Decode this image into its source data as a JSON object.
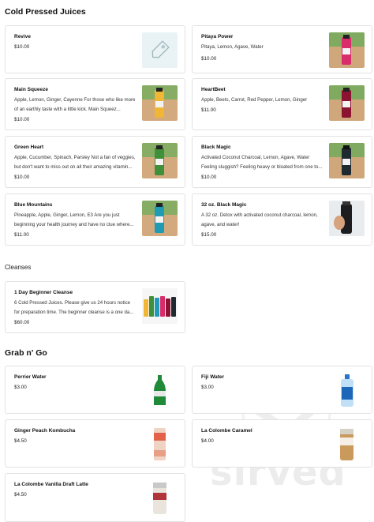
{
  "sections": {
    "cold_pressed": "Cold Pressed Juices",
    "cleanses": "Cleanses",
    "grab_n_go": "Grab n' Go"
  },
  "items": {
    "revive": {
      "name": "Revive",
      "desc": "",
      "price": "$10.00"
    },
    "pitaya": {
      "name": "Pitaya Power",
      "desc": "Pitaya, Lemon, Agave, Water",
      "price": "$10.00"
    },
    "main_squeeze": {
      "name": "Main Squeeze",
      "desc": "Apple, Lemon, Ginger, Cayenne For those who like more of an earthly taste with a little kick. Main Squeez...",
      "price": "$10.00"
    },
    "heartbeet": {
      "name": "HeartBeet",
      "desc": "Apple, Beets, Carrot, Red Pepper, Lemon, Ginger",
      "price": "$11.00"
    },
    "green_heart": {
      "name": "Green Heart",
      "desc": "Apple, Cucumber, Spinach, Parsley Not a fan of veggies, but don't want to miss out on all their amazing vitamin...",
      "price": "$10.00"
    },
    "black_magic": {
      "name": "Black Magic",
      "desc": "Activated Coconut Charcoal, Lemon, Agave, Water Feeling sluggish? Feeling heavy or bloated from one to...",
      "price": "$10.00"
    },
    "blue_mountains": {
      "name": "Blue Mountains",
      "desc": "Pineapple, Apple, Ginger, Lemon, E3 Are you just beginning your health journey and have no clue where...",
      "price": "$11.00"
    },
    "black_magic_32": {
      "name": "32 oz. Black Magic",
      "desc": "A 32 oz. Detox with activated coconut charcoal, lemon, agave, and water!",
      "price": "$15.00"
    },
    "beginner_cleanse": {
      "name": "1 Day Beginner Cleanse",
      "desc": "6 Cold Pressed Juices. Please give us 24 hours notice for preparation time. The beginner cleanse is a one da...",
      "price": "$60.00"
    },
    "perrier": {
      "name": "Perrier Water",
      "price": "$3.00"
    },
    "fiji": {
      "name": "Fiji Water",
      "price": "$3.00"
    },
    "kombucha": {
      "name": "Ginger Peach Kombucha",
      "price": "$4.50"
    },
    "la_colombe_caramel": {
      "name": "La Colombe Caramel",
      "price": "$4.00"
    },
    "la_colombe_vanilla": {
      "name": "La Colombe Vanilla Draft Latte",
      "price": "$4.50"
    }
  },
  "watermark_text": "sirved",
  "icons": [
    "price-tag-icon",
    "fork-knife-icon"
  ],
  "colors": {
    "card_border": "#e2e2e2",
    "tag_bg": "#e9f2f4",
    "watermark": "#ececec"
  }
}
